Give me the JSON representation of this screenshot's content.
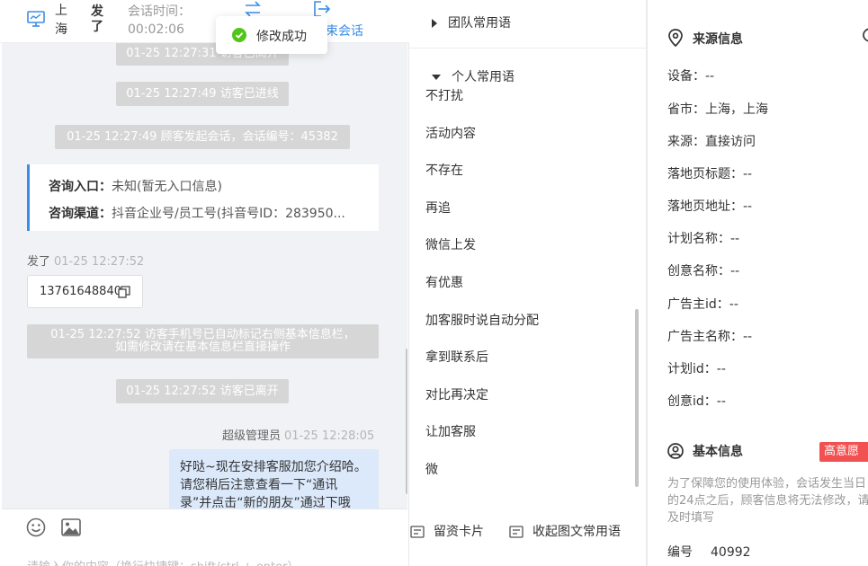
{
  "header": {
    "location": "上海",
    "visitor_name": "发了",
    "time_label": "会话时间：",
    "time_value": "00:02:06",
    "end_label": "束会话"
  },
  "toast": {
    "text": "修改成功"
  },
  "messages": {
    "sys_top": "01-25 12:27:31 访客已离开",
    "sys1": "01-25 12:27:49 访客已进线",
    "sys2": "01-25 12:27:49 顾客发起会话，会话编号：45382",
    "entry_label": "咨询入口：",
    "entry_value": "未知(暂无入口信息)",
    "channel_label": "咨询渠道：",
    "channel_value": "抖音企业号/员工号(抖音号ID：283950...",
    "visitor_sender": "发了",
    "visitor_time": "01-25 12:27:52",
    "visitor_phone": "13761648840",
    "sys3_line1": "01-25 12:27:52 访客手机号已自动标记右侧基本信息栏，",
    "sys3_line2": "如需修改请在基本信息栏直接操作",
    "sys4": "01-25 12:27:52 访客已离开",
    "agent_sender": "超级管理员",
    "agent_time": "01-25 12:28:05",
    "agent_message": "好哒~现在安排客服加您介绍哈。请您稍后注意查看一下“通讯录”并点击“新的朋友”通过下哦"
  },
  "input": {
    "placeholder": "请输入你的内容（换行快捷键：shift/ctrl + enter）"
  },
  "phrases": {
    "team_group": "团队常用语",
    "personal_group": "个人常用语",
    "items": [
      "不打扰",
      "活动内容",
      "不存在",
      "再追",
      "微信上发",
      "有优惠",
      "加客服时说自动分配",
      "拿到联系后",
      "对比再决定",
      "让加客服",
      "微"
    ],
    "tool_card": "留资卡片",
    "tool_collapse": "收起图文常用语"
  },
  "source_info": {
    "title": "来源信息",
    "rows": [
      "设备：--",
      "省市：上海，上海",
      "来源：直接访问",
      "落地页标题：--",
      "落地页地址：--",
      "计划名称：--",
      "创意名称：--",
      "广告主id：--",
      "广告主名称：--",
      "计划id：--",
      "创意id：--"
    ]
  },
  "basic_info": {
    "title": "基本信息",
    "badge": "高意愿",
    "note": "为了保障您的使用体验，会话发生当日的24点之后，顾客信息将无法修改，请及时填写",
    "id_label": "编号",
    "id_value": "40992"
  },
  "colors": {
    "accent": "#3a8ee6",
    "success": "#52c41a",
    "danger": "#f25151",
    "agent_bubble": "#dbe9fb",
    "system_pill": "#d6d6d6"
  }
}
